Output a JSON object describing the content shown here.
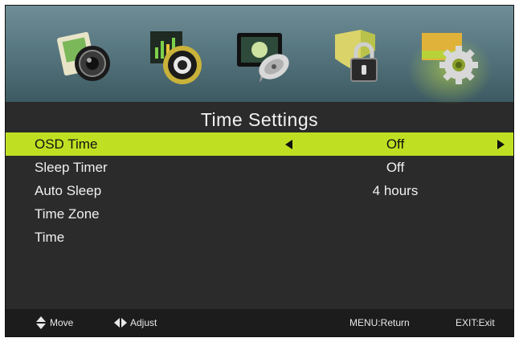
{
  "header": {
    "icons": [
      {
        "name": "picture-icon",
        "selected": false
      },
      {
        "name": "sound-icon",
        "selected": false
      },
      {
        "name": "channel-icon",
        "selected": false
      },
      {
        "name": "lock-icon",
        "selected": false
      },
      {
        "name": "setup-icon",
        "selected": true
      }
    ]
  },
  "menu": {
    "title": "Time Settings",
    "items": [
      {
        "label": "OSD Time",
        "value": "Off"
      },
      {
        "label": "Sleep Timer",
        "value": "Off"
      },
      {
        "label": "Auto Sleep",
        "value": "4 hours"
      },
      {
        "label": "Time Zone",
        "value": ""
      },
      {
        "label": "Time",
        "value": ""
      }
    ],
    "selected_index": 0
  },
  "footer": {
    "move": "Move",
    "adjust": "Adjust",
    "menu_return": "MENU:Return",
    "exit": "EXIT:Exit"
  },
  "colors": {
    "highlight": "#bfe022",
    "background": "#2b2b2b",
    "icon_bar": "#587780"
  }
}
